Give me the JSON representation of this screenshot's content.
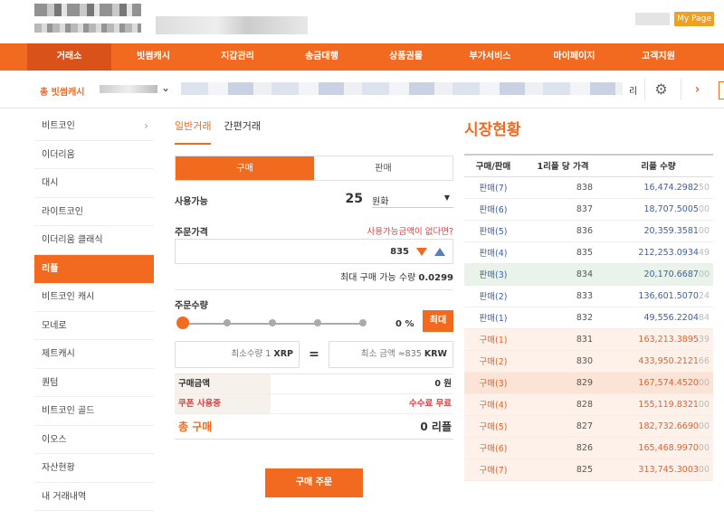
{
  "header": {
    "my_page": "My Page"
  },
  "nav": [
    "거래소",
    "빗썸캐시",
    "지갑관리",
    "송금대행",
    "상품권몰",
    "부가서비스",
    "마이페이지",
    "고객지원"
  ],
  "subbar": {
    "coin_select": "총 빗썸캐시",
    "unit": "리",
    "next": "›"
  },
  "sidebar": [
    {
      "label": "비트코인",
      "arrow": "›"
    },
    {
      "label": "이더리움"
    },
    {
      "label": "대시"
    },
    {
      "label": "라이트코인"
    },
    {
      "label": "이더리움 클래식"
    },
    {
      "label": "리플"
    },
    {
      "label": "비트코인 캐시"
    },
    {
      "label": "모네로"
    },
    {
      "label": "제트캐시"
    },
    {
      "label": "퀀텀"
    },
    {
      "label": "비트코인 골드"
    },
    {
      "label": "이오스"
    },
    {
      "label": "자산현황"
    },
    {
      "label": "내 거래내역"
    }
  ],
  "form": {
    "tab_normal": "일반거래",
    "tab_simple": "간편거래",
    "buy": "구매",
    "sell": "판매",
    "available_label": "사용가능",
    "available_value": "25",
    "available_unit": "원화",
    "price_label": "주문가격",
    "price_link": "사용가능금액이 없다면?",
    "price_value": "835",
    "max_buy_label": "최대 구매 가능 수량",
    "max_buy_value": "0.0299",
    "qty_label": "주문수량",
    "pct": "0 %",
    "max_btn": "최대",
    "min_qty_label": "최소수량 1",
    "min_qty_unit": "XRP",
    "equals": "=",
    "min_amt_label": "최소 금액 ≈835",
    "min_amt_unit": "KRW",
    "buy_amount_label": "구매금액",
    "buy_amount_value": "0 원",
    "coupon_label": "쿠폰 사용중",
    "coupon_value": "수수료 무료",
    "total_label": "총 구매",
    "total_value": "0 리플",
    "order_btn": "구매 주문"
  },
  "market": {
    "title": "시장현황",
    "headers": [
      "구매/판매",
      "1리플 당 가격",
      "리플 수량"
    ],
    "rows": [
      {
        "side": "판매(7)",
        "price": "838",
        "qty": "16,474.2982",
        "qty_tail": "50",
        "type": "sell"
      },
      {
        "side": "판매(6)",
        "price": "837",
        "qty": "18,707.5005",
        "qty_tail": "00",
        "type": "sell"
      },
      {
        "side": "판매(5)",
        "price": "836",
        "qty": "20,359.3581",
        "qty_tail": "00",
        "type": "sell"
      },
      {
        "side": "판매(4)",
        "price": "835",
        "qty": "212,253.0934",
        "qty_tail": "49",
        "type": "sell"
      },
      {
        "side": "판매(3)",
        "price": "834",
        "qty": "20,170.6687",
        "qty_tail": "00",
        "type": "sell-hl"
      },
      {
        "side": "판매(2)",
        "price": "833",
        "qty": "136,601.5070",
        "qty_tail": "24",
        "type": "sell"
      },
      {
        "side": "판매(1)",
        "price": "832",
        "qty": "49,556.2204",
        "qty_tail": "84",
        "type": "sell"
      },
      {
        "side": "구매(1)",
        "price": "831",
        "qty": "163,213.3895",
        "qty_tail": "39",
        "type": "buy"
      },
      {
        "side": "구매(2)",
        "price": "830",
        "qty": "433,950.2121",
        "qty_tail": "66",
        "type": "buy"
      },
      {
        "side": "구매(3)",
        "price": "829",
        "qty": "167,574.4520",
        "qty_tail": "00",
        "type": "buy-hl"
      },
      {
        "side": "구매(4)",
        "price": "828",
        "qty": "155,119.8321",
        "qty_tail": "00",
        "type": "buy"
      },
      {
        "side": "구매(5)",
        "price": "827",
        "qty": "182,732.6690",
        "qty_tail": "00",
        "type": "buy"
      },
      {
        "side": "구매(6)",
        "price": "826",
        "qty": "165,468.9970",
        "qty_tail": "00",
        "type": "buy"
      },
      {
        "side": "구매(7)",
        "price": "825",
        "qty": "313,745.3003",
        "qty_tail": "00",
        "type": "buy"
      }
    ]
  },
  "colors": {
    "accent": "#f26a1f",
    "sell": "#3b5fa8",
    "buy": "#e8602a",
    "link_red": "#e83b3b"
  }
}
